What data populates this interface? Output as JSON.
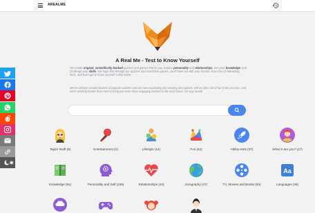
{
  "header": {
    "brand": "AREALME",
    "menu_icon": "hamburger-menu-icon",
    "history_icon": "history-icon"
  },
  "hero": {
    "title": "A Real Me - Test to Know Yourself",
    "intro_p1": [
      {
        "t": "We create ",
        "b": false
      },
      {
        "t": "original",
        "b": true
      },
      {
        "t": ", ",
        "b": false
      },
      {
        "t": "scientifically-backed",
        "b": true
      },
      {
        "t": " quizzes and games that let you explore ",
        "b": false
      },
      {
        "t": "personality",
        "b": true
      },
      {
        "t": " and ",
        "b": false
      },
      {
        "t": "relationships",
        "b": true
      },
      {
        "t": ", test your ",
        "b": false
      },
      {
        "t": "knowledge",
        "b": true
      },
      {
        "t": ", and challenge your ",
        "b": false
      },
      {
        "t": "skills",
        "b": true
      },
      {
        "t": ". We hope that through our quizzes and interactive games, you'll have fun with your friends, learn lots of interesting facts, and even get to know yourself a little better.",
        "b": false
      }
    ],
    "intro_p2": "We've already created dozens of popular quizzes and are now expanding into exciting new games. We've had a lot of fun in the process, and we're working harder than ever to bring you even more engaging content in the near future. So stay tuned!"
  },
  "search": {
    "placeholder": "",
    "button_icon": "search-icon"
  },
  "social": [
    {
      "name": "twitter",
      "color": "#1da1f2"
    },
    {
      "name": "facebook",
      "color": "#1877f2"
    },
    {
      "name": "pinterest",
      "color": "#e60023"
    },
    {
      "name": "whatsapp",
      "color": "#25d366"
    },
    {
      "name": "reddit",
      "color": "#ff4500"
    },
    {
      "name": "instagram",
      "color": "#e1306c"
    },
    {
      "name": "email",
      "color": "#7a7a7a"
    },
    {
      "name": "copy-link",
      "color": "#9a9a9a"
    },
    {
      "name": "dark-mode",
      "color": "#555555"
    }
  ],
  "categories": [
    {
      "label": "Taylor Swift (8)",
      "icon": "taylor-swift-icon"
    },
    {
      "label": "Entertainment (2)",
      "icon": "microphone-icon"
    },
    {
      "label": "Lifestyle (14)",
      "icon": "lifestyle-icon"
    },
    {
      "label": "Fun (52)",
      "icon": "jester-hat-icon"
    },
    {
      "label": "Ability tests (37)",
      "icon": "rocket-icon"
    },
    {
      "label": "What X are you? (17)",
      "icon": "avatar-icon"
    },
    {
      "label": "Knowledge (91)",
      "icon": "book-icon"
    },
    {
      "label": "Personality and Self (136)",
      "icon": "head-gears-icon"
    },
    {
      "label": "Relationships (44)",
      "icon": "heartbeat-icon"
    },
    {
      "label": "Geography (47)",
      "icon": "globe-icon"
    },
    {
      "label": "TV, Movies and Books (84)",
      "icon": "film-reel-icon"
    },
    {
      "label": "Languages (46)",
      "icon": "language-icon"
    },
    {
      "label": "",
      "icon": "brain-icon"
    },
    {
      "label": "",
      "icon": "gamepad-icon"
    },
    {
      "label": "",
      "icon": "girl-icon"
    },
    {
      "label": "",
      "icon": "man-icon"
    }
  ]
}
